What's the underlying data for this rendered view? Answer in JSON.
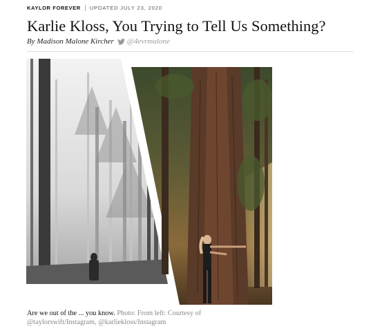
{
  "article": {
    "rubric": "KAYLOR FOREVER",
    "updated": "UPDATED JULY 23, 2020",
    "headline": "Karlie Kloss, You Trying to Tell Us Something?",
    "byline": {
      "author": "By Madison Malone Kircher",
      "twitter_handle": "@4evrmalone",
      "icon": "twitter-bird-icon"
    }
  },
  "image": {
    "description_left": "misty black-and-white forest with a hooded figure",
    "description_right": "color redwood forest with a woman hugging a tree"
  },
  "caption": {
    "text": "Are we out of the ... you know.",
    "credit": "Photo: From left: Courtesy of @taylorswift/Instagram, @karliekloss/Instagram"
  },
  "colors": {
    "accent_rule": "#c9a86a",
    "credit_gray": "#888888",
    "divider": "#dddddd"
  }
}
